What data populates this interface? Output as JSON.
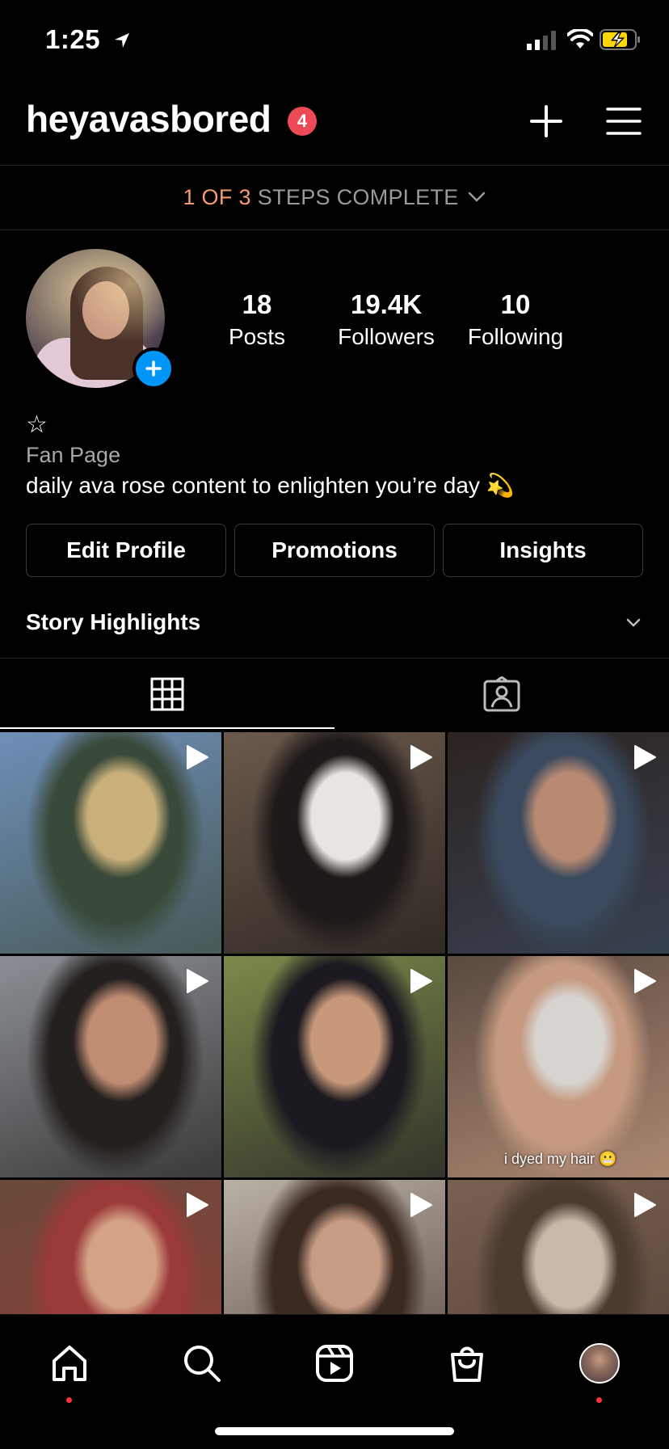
{
  "status_bar": {
    "time": "1:25"
  },
  "header": {
    "username": "heyavasbored",
    "notification_count": "4"
  },
  "steps": {
    "completed": "1 OF 3",
    "label": "STEPS COMPLETE"
  },
  "profile": {
    "stats": [
      {
        "value": "18",
        "label": "Posts"
      },
      {
        "value": "19.4K",
        "label": "Followers"
      },
      {
        "value": "10",
        "label": "Following"
      }
    ],
    "name_symbol": "☆",
    "category": "Fan Page",
    "bio": "daily ava rose content to enlighten you’re day 💫"
  },
  "buttons": {
    "edit": "Edit Profile",
    "promotions": "Promotions",
    "insights": "Insights"
  },
  "story_highlights": {
    "title": "Story Highlights"
  },
  "grid": {
    "posts": [
      {
        "colors": [
          "#6f8fb8",
          "#c9b07a",
          "#3a4a3a"
        ],
        "caption": ""
      },
      {
        "colors": [
          "#6b5a4c",
          "#e8e4df",
          "#1f1a19"
        ],
        "caption": ""
      },
      {
        "colors": [
          "#2c2320",
          "#b88a72",
          "#3b4a5e"
        ],
        "caption": ""
      },
      {
        "colors": [
          "#8b8f95",
          "#c08c72",
          "#24201e"
        ],
        "caption": ""
      },
      {
        "colors": [
          "#7a8a4a",
          "#c7987a",
          "#1c1a20"
        ],
        "caption": ""
      },
      {
        "colors": [
          "#5a4a40",
          "#d7d4d0",
          "#c59a80"
        ],
        "caption": "i dyed my hair 😬"
      },
      {
        "colors": [
          "#6a4a3a",
          "#d4a284",
          "#9b3a3a"
        ],
        "caption": ""
      },
      {
        "colors": [
          "#b9b0a6",
          "#c79c84",
          "#3a2a22"
        ],
        "caption": ""
      },
      {
        "colors": [
          "#7a6050",
          "#c8b8a6",
          "#4a3a30"
        ],
        "caption": ""
      }
    ]
  },
  "accent_colors": {
    "badge": "#ed4956",
    "add_story": "#0095f6",
    "steps_accent": "#f59b6c"
  }
}
